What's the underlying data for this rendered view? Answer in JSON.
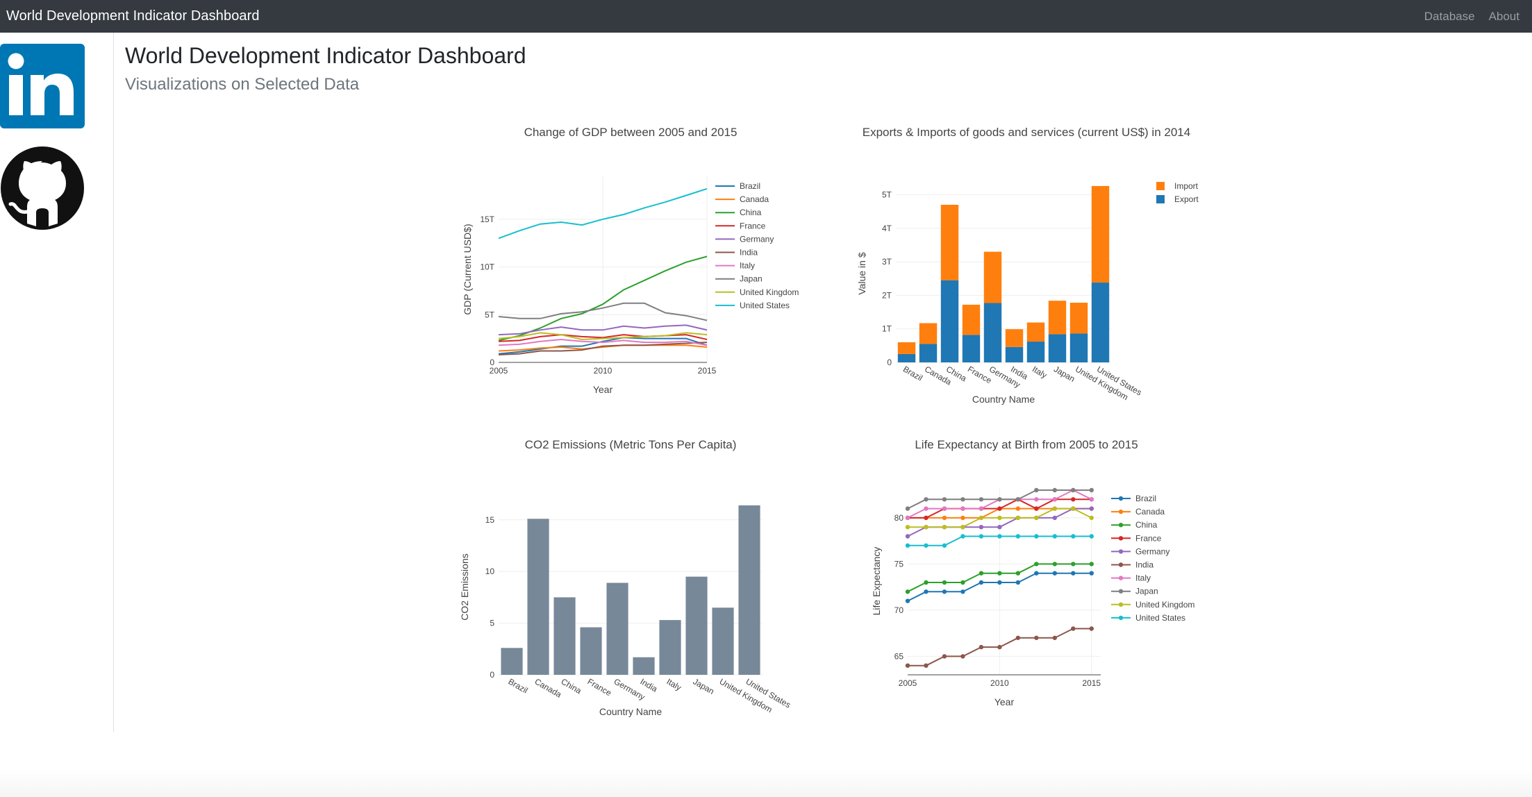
{
  "navbar": {
    "brand": "World Development Indicator Dashboard",
    "links": [
      "Database",
      "About"
    ]
  },
  "sidebar": {
    "icons": [
      "linkedin-icon",
      "github-icon"
    ],
    "colors": {
      "linkedin": "#0077b5",
      "github": "#111111"
    }
  },
  "header": {
    "title": "World Development Indicator Dashboard",
    "subtitle": "Visualizations on Selected Data"
  },
  "colors": {
    "Brazil": "#1f77b4",
    "Canada": "#ff7f0e",
    "China": "#2ca02c",
    "France": "#d62728",
    "Germany": "#9467bd",
    "India": "#8c564b",
    "Italy": "#e377c2",
    "Japan": "#7f7f7f",
    "United Kingdom": "#bcbd22",
    "United States": "#17becf",
    "Import": "#ff7f0e",
    "Export": "#1f77b4",
    "co2_bar": "#778899"
  },
  "chart_data": [
    {
      "id": "gdp",
      "type": "line",
      "title": "Change of GDP between 2005 and 2015",
      "xlabel": "Year",
      "ylabel": "GDP (Current USD$)",
      "xlim": [
        2005,
        2015
      ],
      "ylim": [
        0,
        19.5
      ],
      "x_ticks": [
        2005,
        2010,
        2015
      ],
      "y_ticks": [
        0,
        5,
        10,
        15
      ],
      "y_tick_labels": [
        "0",
        "5T",
        "10T",
        "15T"
      ],
      "legend": "right",
      "x": [
        2005,
        2006,
        2007,
        2008,
        2009,
        2010,
        2011,
        2012,
        2013,
        2014,
        2015
      ],
      "series": [
        {
          "name": "Brazil",
          "values": [
            0.9,
            1.1,
            1.4,
            1.7,
            1.7,
            2.2,
            2.6,
            2.5,
            2.5,
            2.5,
            1.8
          ]
        },
        {
          "name": "Canada",
          "values": [
            1.2,
            1.3,
            1.5,
            1.6,
            1.4,
            1.6,
            1.8,
            1.8,
            1.8,
            1.8,
            1.6
          ]
        },
        {
          "name": "China",
          "values": [
            2.3,
            2.8,
            3.6,
            4.6,
            5.1,
            6.1,
            7.6,
            8.6,
            9.6,
            10.5,
            11.1
          ]
        },
        {
          "name": "France",
          "values": [
            2.2,
            2.3,
            2.7,
            2.9,
            2.7,
            2.6,
            2.9,
            2.7,
            2.8,
            2.9,
            2.4
          ]
        },
        {
          "name": "Germany",
          "values": [
            2.9,
            3.0,
            3.4,
            3.7,
            3.4,
            3.4,
            3.8,
            3.6,
            3.8,
            3.9,
            3.4
          ]
        },
        {
          "name": "India",
          "values": [
            0.8,
            0.9,
            1.2,
            1.2,
            1.3,
            1.7,
            1.8,
            1.8,
            1.9,
            2.0,
            2.1
          ]
        },
        {
          "name": "Italy",
          "values": [
            1.8,
            1.9,
            2.2,
            2.4,
            2.2,
            2.1,
            2.3,
            2.1,
            2.1,
            2.2,
            1.8
          ]
        },
        {
          "name": "Japan",
          "values": [
            4.8,
            4.6,
            4.6,
            5.1,
            5.3,
            5.7,
            6.2,
            6.2,
            5.2,
            4.9,
            4.4
          ]
        },
        {
          "name": "United Kingdom",
          "values": [
            2.5,
            2.7,
            3.1,
            2.9,
            2.4,
            2.5,
            2.6,
            2.7,
            2.8,
            3.1,
            2.9
          ]
        },
        {
          "name": "United States",
          "values": [
            13.0,
            13.8,
            14.5,
            14.7,
            14.4,
            15.0,
            15.5,
            16.2,
            16.8,
            17.5,
            18.2
          ]
        }
      ]
    },
    {
      "id": "trade",
      "type": "bar",
      "stacked": true,
      "title": "Exports & Imports of goods and services (current US$) in 2014",
      "xlabel": "Country Name",
      "ylabel": "Value in $",
      "ylim": [
        0,
        5.3
      ],
      "y_ticks": [
        0,
        1,
        2,
        3,
        4,
        5
      ],
      "y_tick_labels": [
        "0",
        "1T",
        "2T",
        "3T",
        "4T",
        "5T"
      ],
      "legend": "top-right",
      "categories": [
        "Brazil",
        "Canada",
        "China",
        "France",
        "Germany",
        "India",
        "Italy",
        "Japan",
        "United Kingdom",
        "United States"
      ],
      "series": [
        {
          "name": "Export",
          "values": [
            0.25,
            0.55,
            2.45,
            0.82,
            1.77,
            0.46,
            0.62,
            0.84,
            0.86,
            2.38
          ]
        },
        {
          "name": "Import",
          "values": [
            0.35,
            0.62,
            2.25,
            0.9,
            1.53,
            0.53,
            0.57,
            1.0,
            0.92,
            2.88
          ]
        }
      ]
    },
    {
      "id": "co2",
      "type": "bar",
      "title": "CO2 Emissions (Metric Tons Per Capita)",
      "xlabel": "Country Name",
      "ylabel": "CO2 Emissions",
      "ylim": [
        0,
        17
      ],
      "y_ticks": [
        0,
        5,
        10,
        15
      ],
      "categories": [
        "Brazil",
        "Canada",
        "China",
        "France",
        "Germany",
        "India",
        "Italy",
        "Japan",
        "United Kingdom",
        "United States"
      ],
      "values": [
        2.6,
        15.1,
        7.5,
        4.6,
        8.9,
        1.7,
        5.3,
        9.5,
        6.5,
        16.4
      ]
    },
    {
      "id": "life",
      "type": "line",
      "markers": true,
      "title": "Life Expectancy at Birth from 2005 to 2015",
      "xlabel": "Year",
      "ylabel": "Life Expectancy",
      "xlim": [
        2005,
        2015.5
      ],
      "ylim": [
        63,
        83.3
      ],
      "x_ticks": [
        2005,
        2010,
        2015
      ],
      "y_ticks": [
        65,
        70,
        75,
        80
      ],
      "legend": "right",
      "x": [
        2005,
        2006,
        2007,
        2008,
        2009,
        2010,
        2011,
        2012,
        2013,
        2014,
        2015
      ],
      "series": [
        {
          "name": "Brazil",
          "values": [
            71,
            72,
            72,
            72,
            73,
            73,
            73,
            74,
            74,
            74,
            74
          ]
        },
        {
          "name": "Canada",
          "values": [
            80,
            80,
            80,
            80,
            80,
            81,
            81,
            81,
            81,
            81,
            81
          ]
        },
        {
          "name": "China",
          "values": [
            72,
            73,
            73,
            73,
            74,
            74,
            74,
            75,
            75,
            75,
            75
          ]
        },
        {
          "name": "France",
          "values": [
            80,
            80,
            81,
            81,
            81,
            81,
            82,
            81,
            82,
            82,
            82
          ]
        },
        {
          "name": "Germany",
          "values": [
            78,
            79,
            79,
            79,
            79,
            79,
            80,
            80,
            80,
            81,
            81
          ]
        },
        {
          "name": "India",
          "values": [
            64,
            64,
            65,
            65,
            66,
            66,
            67,
            67,
            67,
            68,
            68
          ]
        },
        {
          "name": "Italy",
          "values": [
            80,
            81,
            81,
            81,
            81,
            82,
            82,
            82,
            82,
            83,
            82
          ]
        },
        {
          "name": "Japan",
          "values": [
            81,
            82,
            82,
            82,
            82,
            82,
            82,
            83,
            83,
            83,
            83
          ]
        },
        {
          "name": "United Kingdom",
          "values": [
            79,
            79,
            79,
            79,
            80,
            80,
            80,
            80,
            81,
            81,
            80
          ]
        },
        {
          "name": "United States",
          "values": [
            77,
            77,
            77,
            78,
            78,
            78,
            78,
            78,
            78,
            78,
            78
          ]
        }
      ]
    }
  ]
}
